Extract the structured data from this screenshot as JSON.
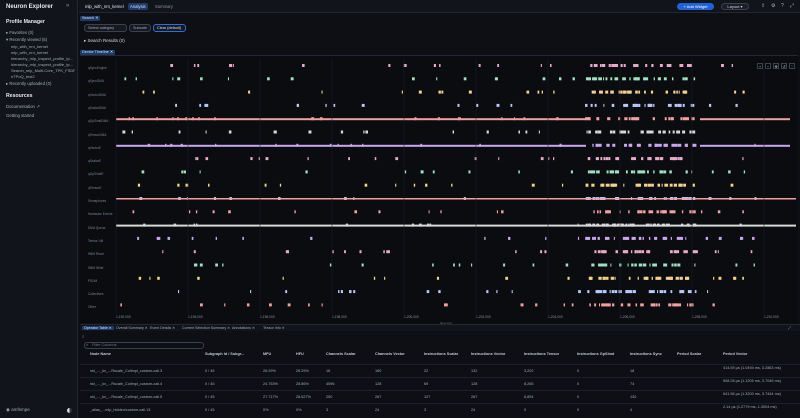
{
  "app": {
    "title": "Neuron Explorer"
  },
  "sidebar": {
    "profile_manager": "Profile Manager",
    "favorites": "Favorites (0)",
    "recently_viewed": "Recently viewed (5)",
    "profiles": [
      "mlp_with_nrn_kernel",
      "mlp_with_nrn_kernel",
      "hierarchy_mlp_inspect_profile_tp...",
      "hierarchy_mlp_inspect_profile_tp...",
      "Search_mlp_Multi-Core_TPK_FSDP...",
      "nTPoQ_test2"
    ],
    "recently_uploaded": "Recently uploaded (0)",
    "resources": "Resources",
    "documentation": "Documentation ↗",
    "getting_started": "Getting started",
    "user": "amfsmpe"
  },
  "topbar": {
    "profile_name": "mlp_with_nrn_kernel",
    "tab_analysis": "Analysis",
    "tab_summary": "Summary",
    "add_widget": "+ Add Widget",
    "layout": "Layout ▾"
  },
  "search": {
    "panel_tag": "Search ✕",
    "select_category": "Select category",
    "subcategory": "Subcate",
    "clear": "Clear (default)",
    "results": "▸ Search Results (0)"
  },
  "timeline": {
    "panel_tag": "Device Timeline ✕",
    "rows": [
      "qSyncEngine",
      "qSyncDMA",
      "qVectorDMA",
      "qScalarDMA",
      "qGpSimdDMA",
      "qTensorDMA",
      "qVectorE",
      "qScalarE",
      "qGpSimdE",
      "qTensorE",
      "Semaphores",
      "Hardware Events",
      "DMA Queue",
      "Tensor Util",
      "HBM Read",
      "HBM Write",
      "PSUM",
      "Collectives",
      "Other"
    ],
    "ticks": [
      "1,192,000",
      "1,194,000",
      "1,196,000",
      "1,198,000",
      "1,200,000",
      "1,202,000",
      "1,204,000",
      "1,206,000",
      "1,208,000",
      "1,210,000"
    ],
    "axis_label": "time (ns)"
  },
  "bottom": {
    "tabs": [
      "Operator Table ✕",
      "Overall Summary ✕",
      "Event Details ✕",
      "Current Selection Summary ✕",
      "Annotations ✕",
      "Tensor Info ✕"
    ],
    "filter_placeholder": "Filter Columns",
    "headers": [
      "Node Name",
      "Subgraph Id / Subgr...",
      "MFU",
      "HFU",
      "Channels Scalar",
      "Channels Vector",
      "Instructions Scalar",
      "Instructions Vector",
      "Instructions Tensor",
      "Instructions GpSimd",
      "Instructions Sync",
      "Period Scalar",
      "Period Vector"
    ],
    "rows": [
      [
        "nki_..._kv_...Rscale_Collmpl_custom-call.3",
        "0 / 45",
        "26.29%",
        "26.29%",
        "16",
        "160",
        "22",
        "132",
        "3,202",
        "0",
        "18",
        "",
        "414.59 µs (1.0494 ms, 3.2863 ms)"
      ],
      [
        "nki_..._kv_...Rscale_Collmpl_custom-call.4",
        "0 / 45",
        "24.753%",
        "28.86%",
        "4596",
        "128",
        "69",
        "128",
        "8,265",
        "0",
        "74",
        "",
        "508.28 µs (1.1205 ms, 3.7045 ms)"
      ],
      [
        "nki_..._kv_...Rscale_Collmpl_custom-call.5",
        "0 / 45",
        "27.717%",
        "28.627%",
        "250",
        "267",
        "127",
        "267",
        "6,894",
        "0",
        "130",
        "",
        "641.56 µs (1.3200 ms, 3.7444 ms)"
      ],
      [
        "_alias_...mlp_hidden/custom-call.13",
        "0 / 45",
        "0%",
        "0%",
        "3",
        "24",
        "3",
        "24",
        "0",
        "0",
        "4",
        "",
        "2.14 µs (1.2779 ms, 1.3004 ms)"
      ]
    ]
  }
}
